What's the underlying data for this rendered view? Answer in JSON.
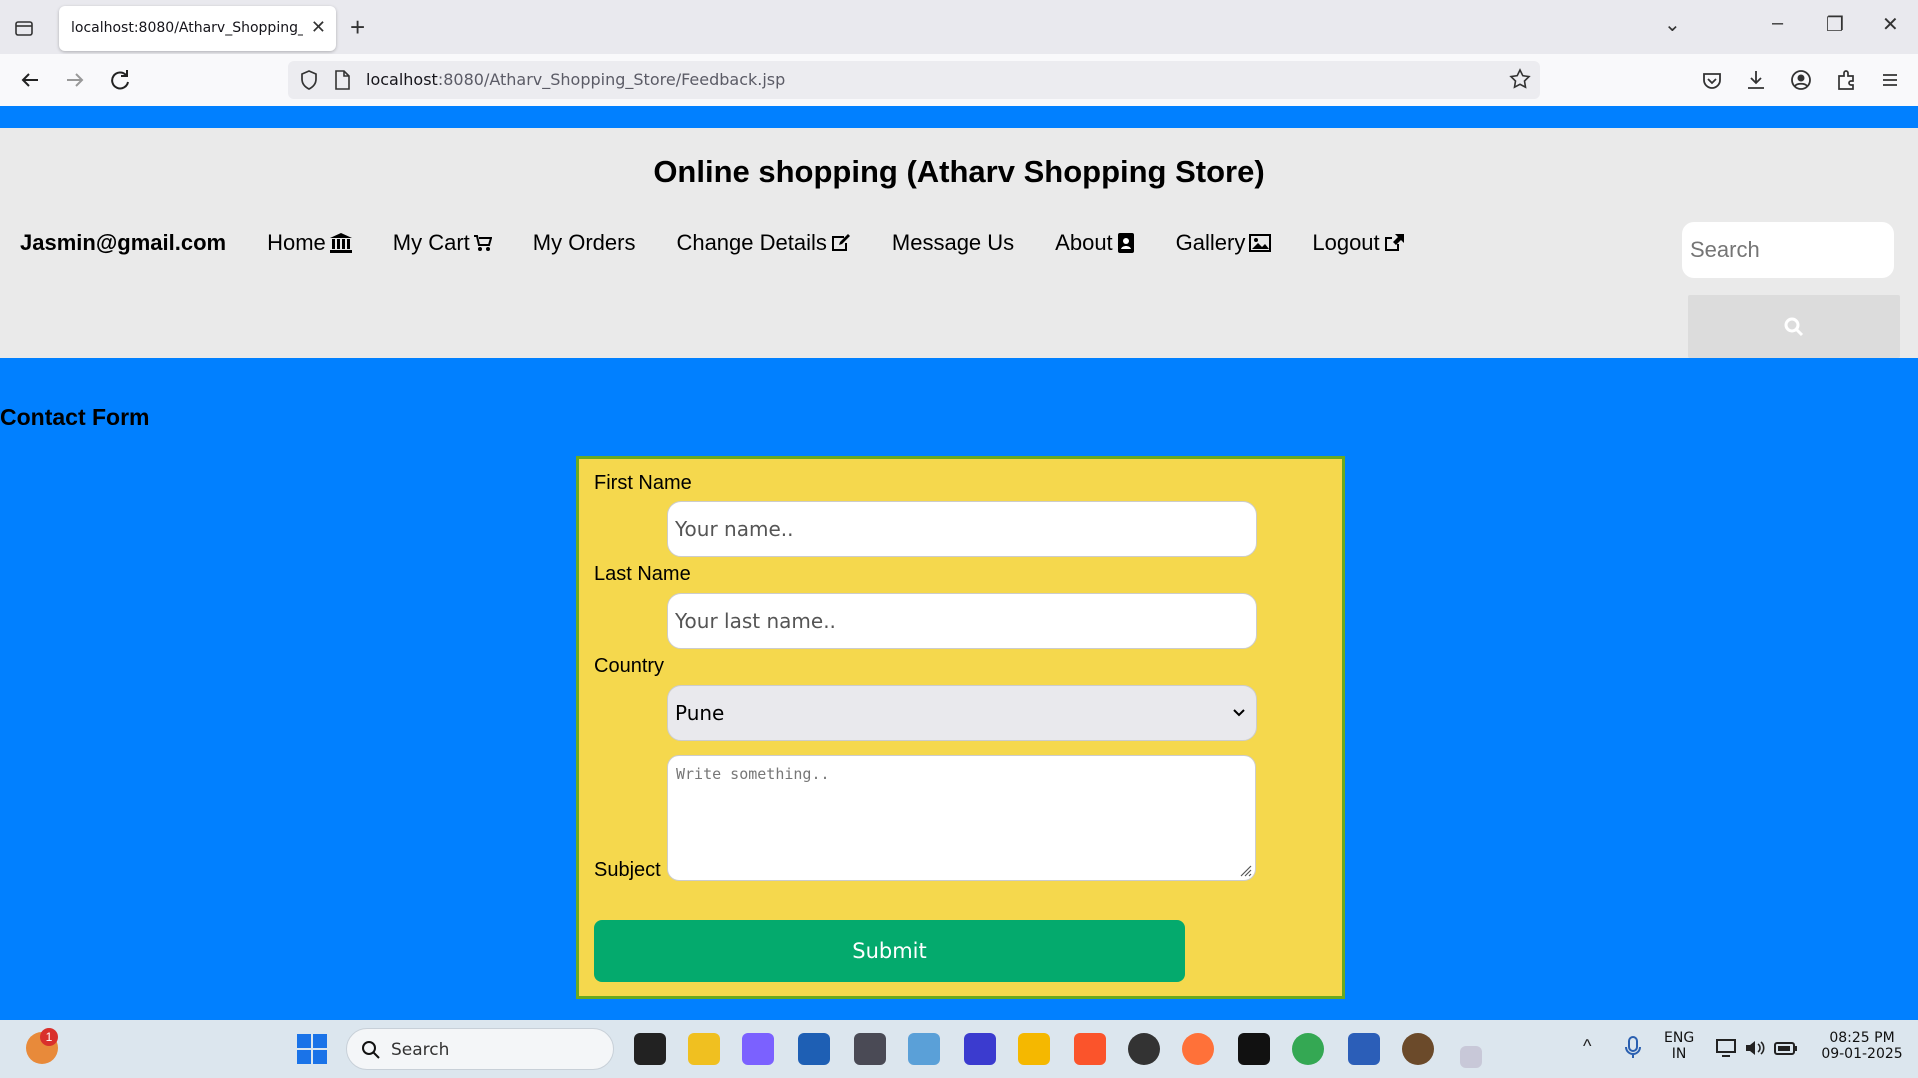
{
  "browser": {
    "tab_title": "localhost:8080/Atharv_Shopping_St",
    "url_host": "localhost",
    "url_rest": ":8080/Atharv_Shopping_Store/Feedback.jsp"
  },
  "header": {
    "title": "Online shopping (Atharv Shopping Store)",
    "user": "Jasmin@gmail.com",
    "menu": [
      {
        "label": "Home",
        "icon": "bank-icon"
      },
      {
        "label": "My Cart",
        "icon": "cart-icon"
      },
      {
        "label": "My Orders",
        "icon": ""
      },
      {
        "label": "Change Details",
        "icon": "edit-icon"
      },
      {
        "label": "Message Us",
        "icon": ""
      },
      {
        "label": "About",
        "icon": "contact-book-icon"
      },
      {
        "label": "Gallery",
        "icon": "image-icon"
      },
      {
        "label": "Logout",
        "icon": "share-icon"
      }
    ],
    "search_placeholder": "Search"
  },
  "contact": {
    "title": "Contact Form",
    "first_name_label": "First Name",
    "first_name_placeholder": "Your name..",
    "last_name_label": "Last Name",
    "last_name_placeholder": "Your last name..",
    "country_label": "Country",
    "country_value": "Pune",
    "subject_label": "Subject",
    "subject_placeholder": "Write something..",
    "submit_label": "Submit"
  },
  "taskbar": {
    "search_label": "Search",
    "notification_count": "1",
    "lang_line1": "ENG",
    "lang_line2": "IN",
    "time": "08:25 PM",
    "date": "09-01-2025"
  },
  "colors": {
    "page_bg": "#0180ff",
    "header_bg": "#eaeaea",
    "form_bg": "#f5d84d",
    "form_border": "#6aa91f",
    "submit_bg": "#04aa6d"
  }
}
